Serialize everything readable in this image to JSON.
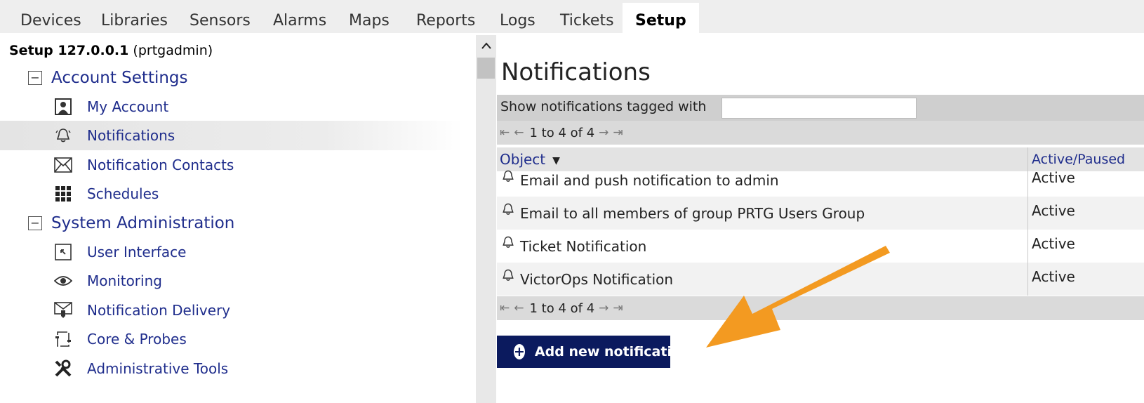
{
  "topnav": {
    "tabs": [
      {
        "label": "Devices"
      },
      {
        "label": "Libraries"
      },
      {
        "label": "Sensors"
      },
      {
        "label": "Alarms"
      },
      {
        "label": "Maps"
      },
      {
        "label": "Reports"
      },
      {
        "label": "Logs"
      },
      {
        "label": "Tickets"
      },
      {
        "label": "Setup",
        "active": true
      }
    ]
  },
  "sidebar": {
    "title_bold": "Setup  127.0.0.1",
    "title_user": "(prtgadmin)",
    "groups": [
      {
        "label": "Account Settings",
        "collapse_symbol": "−",
        "items": [
          {
            "label": "My Account",
            "icon": "user-icon"
          },
          {
            "label": "Notifications",
            "icon": "bell-icon",
            "selected": true
          },
          {
            "label": "Notification Contacts",
            "icon": "envelope-icon"
          },
          {
            "label": "Schedules",
            "icon": "grid-icon"
          }
        ]
      },
      {
        "label": "System Administration",
        "collapse_symbol": "−",
        "items": [
          {
            "label": "User Interface",
            "icon": "cursor-icon"
          },
          {
            "label": "Monitoring",
            "icon": "eye-icon"
          },
          {
            "label": "Notification Delivery",
            "icon": "delivery-icon"
          },
          {
            "label": "Core & Probes",
            "icon": "probes-icon"
          },
          {
            "label": "Administrative Tools",
            "icon": "tools-icon"
          }
        ]
      }
    ]
  },
  "main": {
    "title": "Notifications",
    "filter_label": "Show notifications tagged with",
    "filter_value": "",
    "pager_text": "1 to 4 of 4",
    "columns": {
      "object": "Object",
      "status": "Active/Paused"
    },
    "rows": [
      {
        "name": "Email and push notification to admin",
        "status": "Active"
      },
      {
        "name": "Email to all members of group PRTG Users Group",
        "status": "Active"
      },
      {
        "name": "Ticket Notification",
        "status": "Active"
      },
      {
        "name": "VictorOps Notification",
        "status": "Active"
      }
    ],
    "add_button_label": "Add new notification"
  },
  "colors": {
    "link": "#1f2d8c",
    "button_bg": "#0b1a5e",
    "annotation_arrow": "#f39a21"
  }
}
